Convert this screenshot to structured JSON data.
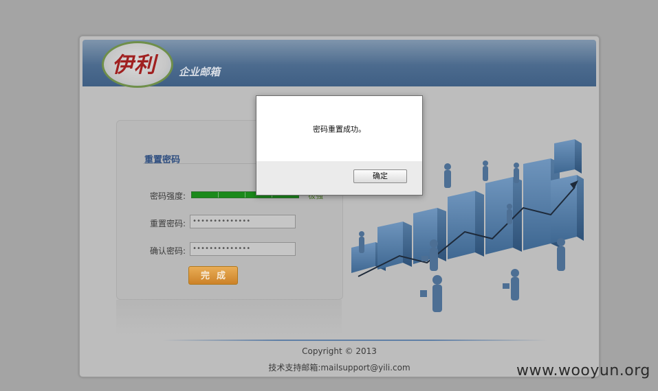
{
  "header": {
    "logo_text": "伊利",
    "title": "企业邮箱"
  },
  "form": {
    "title": "重置密码",
    "strength_label": "密码强度:",
    "strength_text": "极强",
    "strength_level": 1.0,
    "reset_password_label": "重置密码:",
    "reset_password_value": "••••••••••••••",
    "confirm_password_label": "确认密码:",
    "confirm_password_value": "••••••••••••••",
    "submit_label": "完成"
  },
  "footer": {
    "copyright": "Copyright © 2013",
    "support": "技术支持邮箱:mailsupport@yili.com"
  },
  "dialog": {
    "message": "密码重置成功。",
    "ok_label": "确定"
  },
  "watermark": "www.wooyun.org",
  "colors": {
    "header_blue": "#4c6b8e",
    "strength_green": "#1b8a1b",
    "button_orange": "#cc8228",
    "chart_blue": "#4f7aa6"
  }
}
